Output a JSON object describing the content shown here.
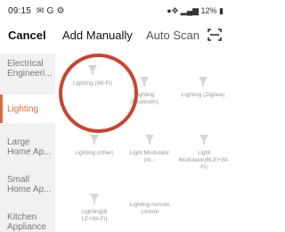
{
  "status": {
    "time": "09:15",
    "right_text": "●\u0018 ▁▃▅ 12%▐"
  },
  "header": {
    "cancel": "Cancel",
    "add_manually": "Add Manually",
    "auto_scan": "Auto Scan"
  },
  "sidebar": {
    "items": [
      {
        "label": "Electrical Engineeri..."
      },
      {
        "label": "Lighting"
      },
      {
        "label": "Large Home Ap..."
      },
      {
        "label": "Small Home Ap..."
      },
      {
        "label": "Kitchen Appliance"
      }
    ]
  },
  "devices": [
    {
      "label": "Lighting (Wi-Fi)"
    },
    {
      "label": "Lighting (Bluetooth)"
    },
    {
      "label": "Lighting (Zigbee)"
    },
    {
      "label": "Lighting (other)"
    },
    {
      "label": "Light Modulator (ot..."
    },
    {
      "label": "Light Modulator(BLE+Wi-Fi)"
    },
    {
      "label": "Lighting(B LE+Wi-Fi)"
    },
    {
      "label": "Lighting remote control"
    }
  ],
  "colors": {
    "accent": "#e0693a",
    "highlight_ring": "#c8452f",
    "sidebar_bg": "#f1f1f3"
  },
  "icons": {
    "device": "light-bulb-icon",
    "scan": "scan-icon"
  }
}
